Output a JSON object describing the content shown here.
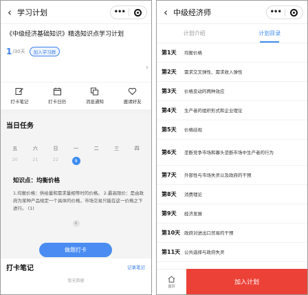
{
  "left": {
    "nav_title": "学习计划",
    "capsule_dots": "•••",
    "plan_title": "《中级经济基础知识》精选知识点学习计划",
    "progress_current": "1",
    "progress_total": "/30天",
    "join_group": "加入学习群",
    "menu": [
      {
        "label": "打卡笔记",
        "icon": "note-edit-icon"
      },
      {
        "label": "打卡日历",
        "icon": "calendar-icon"
      },
      {
        "label": "消息通知",
        "icon": "message-icon"
      },
      {
        "label": "邀请好友",
        "icon": "heart-share-icon"
      }
    ],
    "today_task": "当日任务",
    "weekdays": [
      "五",
      "六",
      "日",
      "一",
      "二",
      "三",
      "四"
    ],
    "dates": [
      "20",
      "21",
      "22",
      "9",
      "",
      "",
      ""
    ],
    "active_date_index": 3,
    "knowledge_title": "知识点：均衡价格",
    "knowledge_body": "1.均衡价格：供给量和需求量相等时的价格。 2.最高限价：是由政府为某种产品规定一个具体的价格，市场交易只能在这一价格之下进行。 (1)",
    "punch_button": "做题打卡",
    "notes_title": "打卡笔记",
    "notes_link": "记录笔记",
    "empty_text": "暂无数据"
  },
  "right": {
    "nav_title": "中级经济师",
    "capsule_dots": "•••",
    "tabs": [
      "计划介绍",
      "计划目录"
    ],
    "active_tab": 1,
    "days": [
      {
        "day": "第1天",
        "topic": "均衡价格"
      },
      {
        "day": "第2天",
        "topic": "需求交叉弹性、需求收入弹性"
      },
      {
        "day": "第3天",
        "topic": "价格变动的两种效应"
      },
      {
        "day": "第4天",
        "topic": "生产者的组织形式和企业理论"
      },
      {
        "day": "第5天",
        "topic": "价格歧视"
      },
      {
        "day": "第6天",
        "topic": "垄断竞争市场和寡头垄断市场中生产者的行为"
      },
      {
        "day": "第7天",
        "topic": "外部性与市场失灵以及政府的干预"
      },
      {
        "day": "第8天",
        "topic": "消费理论"
      },
      {
        "day": "第9天",
        "topic": "经济发展"
      },
      {
        "day": "第10天",
        "topic": "政府对进出口贸易的干预"
      },
      {
        "day": "第11天",
        "topic": "公共选择与政府失灵"
      }
    ],
    "home_label": "首页",
    "add_plan": "加入计划"
  },
  "colors": {
    "accent_blue": "#3d8cf0",
    "add_plan_red": "#ec4137"
  }
}
